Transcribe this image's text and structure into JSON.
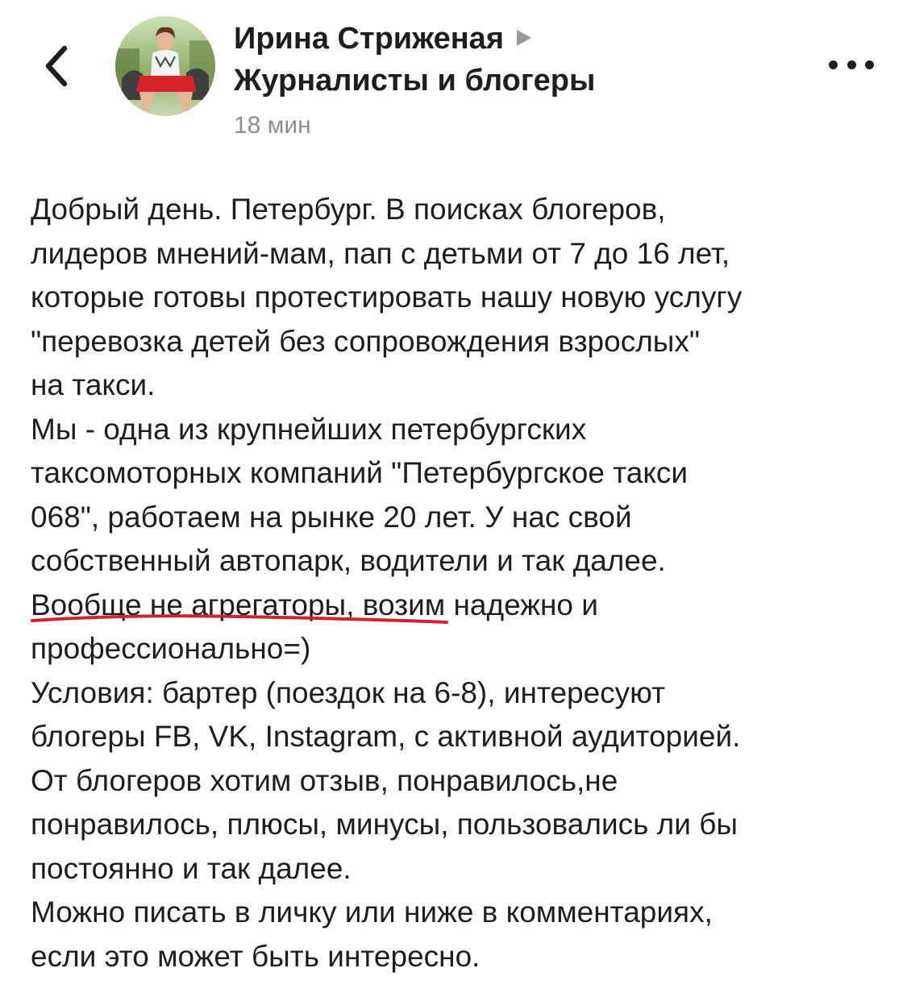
{
  "header": {
    "author_name": "Ирина Стриженая",
    "group_name": "Журналисты и блогеры",
    "timestamp": "18 мин",
    "icons": {
      "back": "chevron-left-icon",
      "arrow": "triangle-right-icon",
      "more": "more-dots-icon"
    }
  },
  "post": {
    "lines": [
      "Добрый день. Петербург. В поисках блогеров,",
      "лидеров мнений-мам, пап с детьми от 7 до 16 лет,",
      "которые готовы протестировать нашу новую услугу",
      "\"перевозка детей без сопровождения взрослых\"",
      "на такси.",
      "Мы - одна из крупнейших петербургских",
      "таксомоторных компаний \"Петербургское такси",
      "068\", работаем на рынке 20 лет. У нас свой",
      "собственный автопарк, водители и так далее.",
      "Вообще не агрегаторы, возим надежно и",
      "профессионально=)",
      "Условия: бартер (поездок на 6-8), интересуют",
      "блогеры FB, VK, Instagram, с активной аудиторией.",
      "От блогеров хотим отзыв, понравилось,не",
      "понравилось, плюсы, минусы, пользовались ли бы",
      "постоянно и так далее.",
      "Можно писать в личку или ниже в комментариях,",
      "если это может быть интересно."
    ]
  },
  "colors": {
    "text": "#1c1e21",
    "secondary": "#8e8e93",
    "arrow": "#9a9a9a",
    "underline": "#d0232f"
  }
}
